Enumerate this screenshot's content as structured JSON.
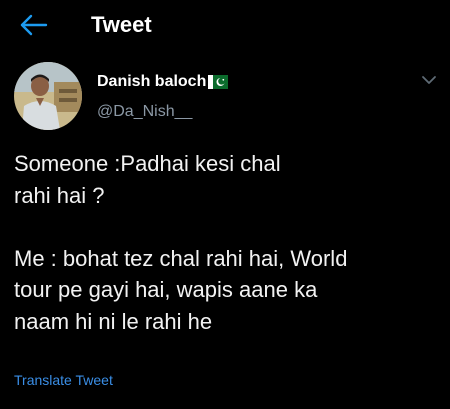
{
  "header": {
    "title": "Tweet"
  },
  "author": {
    "display_name": "Danish baloch",
    "handle": "@Da_Nish__",
    "badge_icon": "pakistan-flag-icon"
  },
  "tweet": {
    "text": "Someone :Padhai kesi chal\nrahi hai ?\n\nMe : bohat tez chal rahi hai, World\ntour pe gayi hai, wapis aane ka\nnaam hi ni le rahi he",
    "translate_label": "Translate Tweet"
  },
  "icons": {
    "back": "back-arrow-icon",
    "more": "chevron-down-icon"
  },
  "colors": {
    "background": "#000000",
    "accent": "#1d9bf0",
    "translate_link": "#3a8ee6",
    "secondary_text": "#8b98a5"
  }
}
